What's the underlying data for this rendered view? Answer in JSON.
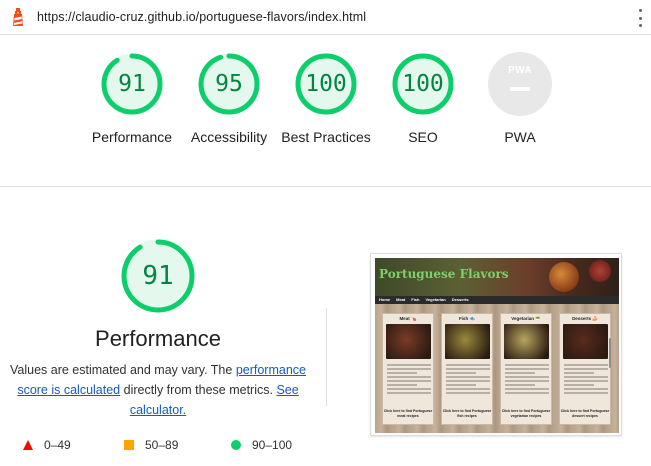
{
  "url": "https://claudio-cruz.github.io/portuguese-flavors/index.html",
  "colors": {
    "pass": "#0cce6b",
    "pass_text": "#018642",
    "average": "#ffa400",
    "fail": "#eb0f00",
    "na": "#e8e8e8"
  },
  "gauges": [
    {
      "name": "performance",
      "score": "91",
      "value": 0.91,
      "label": "Performance"
    },
    {
      "name": "accessibility",
      "score": "95",
      "value": 0.95,
      "label": "Accessibility"
    },
    {
      "name": "best-practices",
      "score": "100",
      "value": 1.0,
      "label": "Best Practices"
    },
    {
      "name": "seo",
      "score": "100",
      "value": 1.0,
      "label": "SEO"
    }
  ],
  "pwa": {
    "badge": "PWA",
    "label": "PWA"
  },
  "performance": {
    "score": "91",
    "value": 0.91,
    "title": "Performance",
    "desc_prefix": "Values are estimated and may vary. The ",
    "link1": "performance score is calculated",
    "desc_middle": " directly from these metrics. ",
    "link2": "See calculator."
  },
  "legend": {
    "fail": "0–49",
    "average": "50–89",
    "pass": "90–100"
  },
  "screenshot": {
    "site_title": "Portuguese Flavors",
    "nav": [
      "Home",
      "Meat",
      "Fish",
      "Vegetarian",
      "Desserts"
    ],
    "cards": [
      {
        "title": "Meat 🍗",
        "footer": "Click here to find Portuguese meat recipes",
        "img": "#7a3b25"
      },
      {
        "title": "Fish 🐟",
        "footer": "Click here to find Portuguese fish recipes",
        "img": "#9a8a3c"
      },
      {
        "title": "Vegetarian 🥗",
        "footer": "Click here to find Portuguese vegetarian recipes",
        "img": "#b8a560"
      },
      {
        "title": "Desserts 🍰",
        "footer": "Click here to find Portuguese dessert recipes",
        "img": "#5a2a1c"
      }
    ]
  }
}
